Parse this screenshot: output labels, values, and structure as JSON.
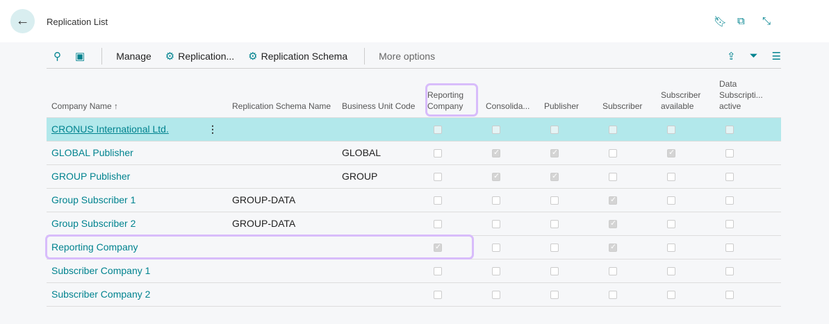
{
  "header": {
    "title": "Replication List"
  },
  "toolbar": {
    "manage": "Manage",
    "replication": "Replication...",
    "schema": "Replication Schema",
    "more": "More options"
  },
  "columns": [
    "Company Name",
    "Replication Schema Name",
    "Business Unit Code",
    "Reporting Company",
    "Consolida...",
    "Publisher",
    "Subscriber",
    "Subscriber available",
    "Data Subscripti... active"
  ],
  "sort_indicator": "↑",
  "rows": [
    {
      "name": "CRONUS International Ltd.",
      "schema": "",
      "bu": "",
      "checks": [
        false,
        false,
        false,
        false,
        false,
        false
      ]
    },
    {
      "name": "GLOBAL Publisher",
      "schema": "",
      "bu": "GLOBAL",
      "checks": [
        false,
        true,
        true,
        false,
        true,
        false
      ]
    },
    {
      "name": "GROUP Publisher",
      "schema": "",
      "bu": "GROUP",
      "checks": [
        false,
        true,
        true,
        false,
        false,
        false
      ]
    },
    {
      "name": "Group Subscriber 1",
      "schema": "GROUP-DATA",
      "bu": "",
      "checks": [
        false,
        false,
        false,
        true,
        false,
        false
      ]
    },
    {
      "name": "Group Subscriber 2",
      "schema": "GROUP-DATA",
      "bu": "",
      "checks": [
        false,
        false,
        false,
        true,
        false,
        false
      ]
    },
    {
      "name": "Reporting Company",
      "schema": "",
      "bu": "",
      "checks": [
        true,
        false,
        false,
        true,
        false,
        false
      ]
    },
    {
      "name": "Subscriber Company 1",
      "schema": "",
      "bu": "",
      "checks": [
        false,
        false,
        false,
        false,
        false,
        false
      ]
    },
    {
      "name": "Subscriber Company 2",
      "schema": "",
      "bu": "",
      "checks": [
        false,
        false,
        false,
        false,
        false,
        false
      ]
    }
  ]
}
